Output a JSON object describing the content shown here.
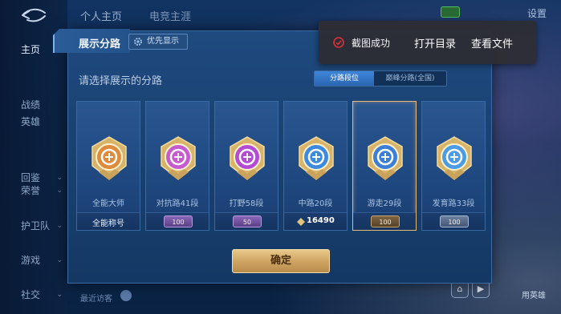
{
  "app": {
    "top_tabs": [
      "个人主页",
      "电竞主涯"
    ],
    "settings_label": "设置",
    "recent_label": "最近访客",
    "hero_corner_label": "用英雄"
  },
  "sidebar": {
    "items": [
      {
        "label": "主页",
        "active": true,
        "has_chevron": false
      },
      {
        "label": "战绩",
        "active": false,
        "has_chevron": false
      },
      {
        "label": "英雄",
        "active": false,
        "has_chevron": false
      },
      {
        "label": "回鉴",
        "active": false,
        "has_chevron": true
      },
      {
        "label": "荣誉",
        "active": false,
        "has_chevron": true
      },
      {
        "label": "护卫队",
        "active": false,
        "has_chevron": true
      },
      {
        "label": "游戏",
        "active": false,
        "has_chevron": true
      },
      {
        "label": "社交",
        "active": false,
        "has_chevron": true
      }
    ]
  },
  "modal": {
    "title": "展示分路",
    "priority_label": "优先显示",
    "subtitle": "请选择展示的分路",
    "segments": [
      {
        "label": "分路段位",
        "active": true
      },
      {
        "label": "巅峰分路(全国)",
        "active": false
      }
    ],
    "cards": [
      {
        "label": "全能大师",
        "foot_type": "text",
        "foot_text": "全能称号",
        "emblem": "all-round-master-emblem",
        "color": "#e08a3c",
        "selected": false
      },
      {
        "label": "对抗路41段",
        "foot_type": "badge",
        "foot_text": "100",
        "badge_style": "purple",
        "emblem": "clash-lane-emblem",
        "color": "#c85ad0",
        "selected": false
      },
      {
        "label": "打野58段",
        "foot_type": "badge",
        "foot_text": "50",
        "badge_style": "purple",
        "emblem": "jungle-emblem",
        "color": "#b54ad4",
        "selected": false
      },
      {
        "label": "中路20段",
        "foot_type": "points",
        "foot_text": "16490",
        "emblem": "mid-lane-emblem",
        "color": "#3c8be0",
        "selected": false
      },
      {
        "label": "游走29段",
        "foot_type": "badge",
        "foot_text": "100",
        "badge_style": "bronze",
        "emblem": "roam-emblem",
        "color": "#3b7fd8",
        "selected": true
      },
      {
        "label": "发育路33段",
        "foot_type": "badge",
        "foot_text": "100",
        "badge_style": "silver",
        "emblem": "farm-lane-emblem",
        "color": "#4c9be6",
        "selected": false
      }
    ],
    "confirm_label": "确定"
  },
  "toast": {
    "message": "截图成功",
    "actions": [
      "打开目录",
      "查看文件"
    ],
    "accent": "#e0303a"
  }
}
